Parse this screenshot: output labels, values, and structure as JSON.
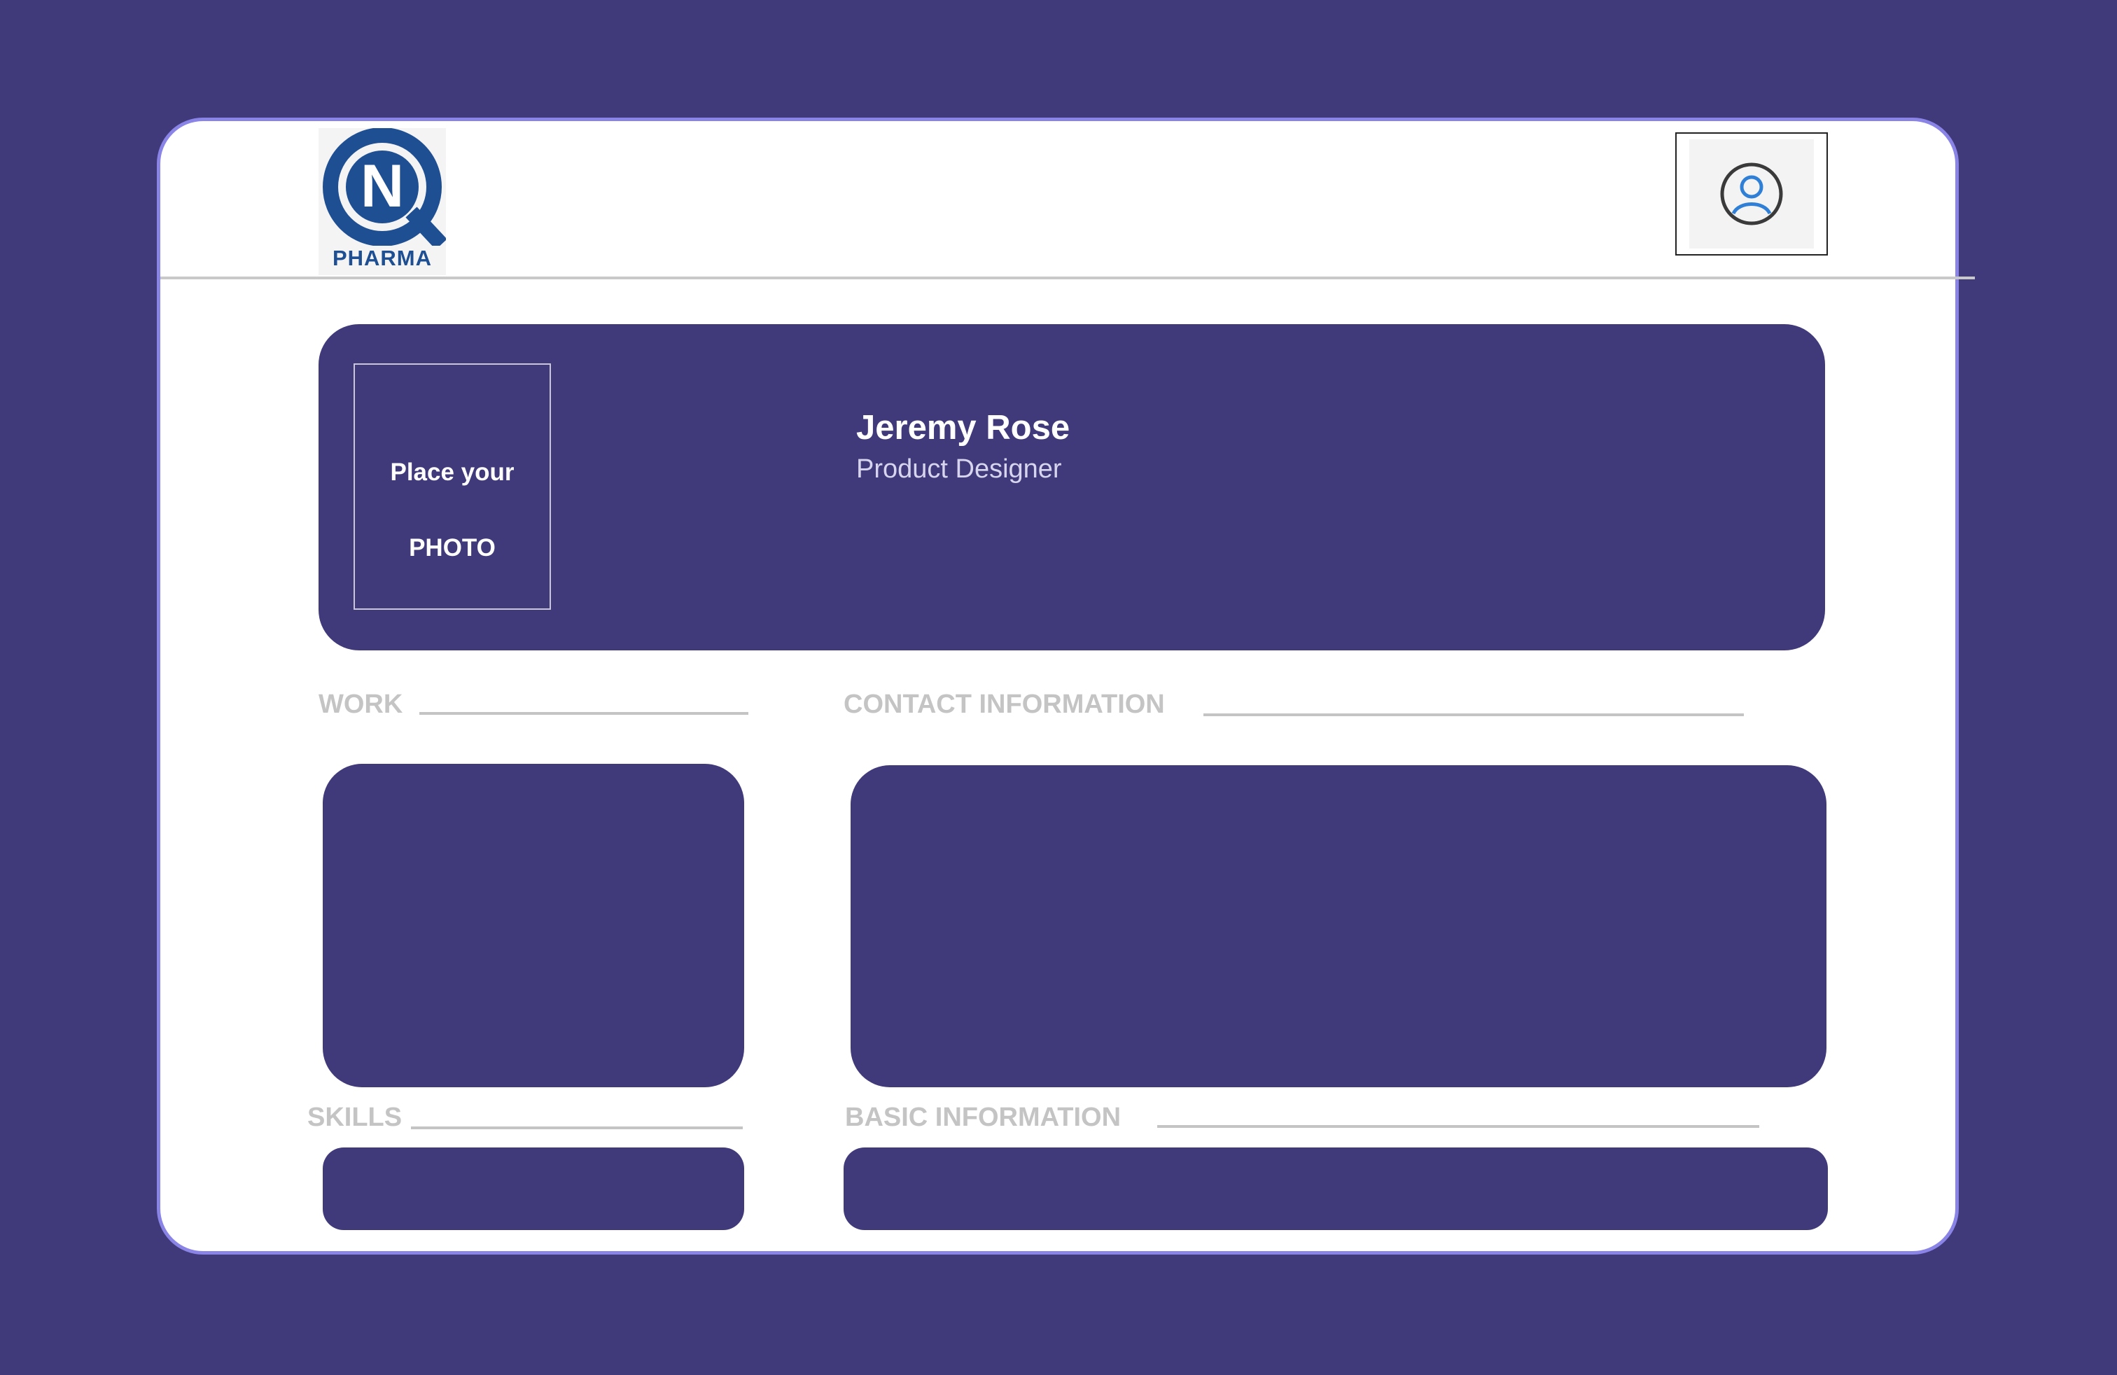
{
  "brand": {
    "logo_letter": "N",
    "logo_text": "PHARMA",
    "logo_color": "#1e4f93"
  },
  "header": {
    "profile_icon": "user-circle-icon"
  },
  "profile": {
    "photo_line1": "Place your",
    "photo_line2": "PHOTO",
    "name": "Jeremy Rose",
    "title": "Product Designer"
  },
  "sections": {
    "work": "WORK",
    "contact": "CONTACT INFORMATION",
    "skills": "SKILLS",
    "basic": "BASIC INFORMATION"
  },
  "colors": {
    "background": "#403a7b",
    "card": "#ffffff",
    "card_border": "#8a84e6",
    "section_title": "#c4c4c4"
  }
}
